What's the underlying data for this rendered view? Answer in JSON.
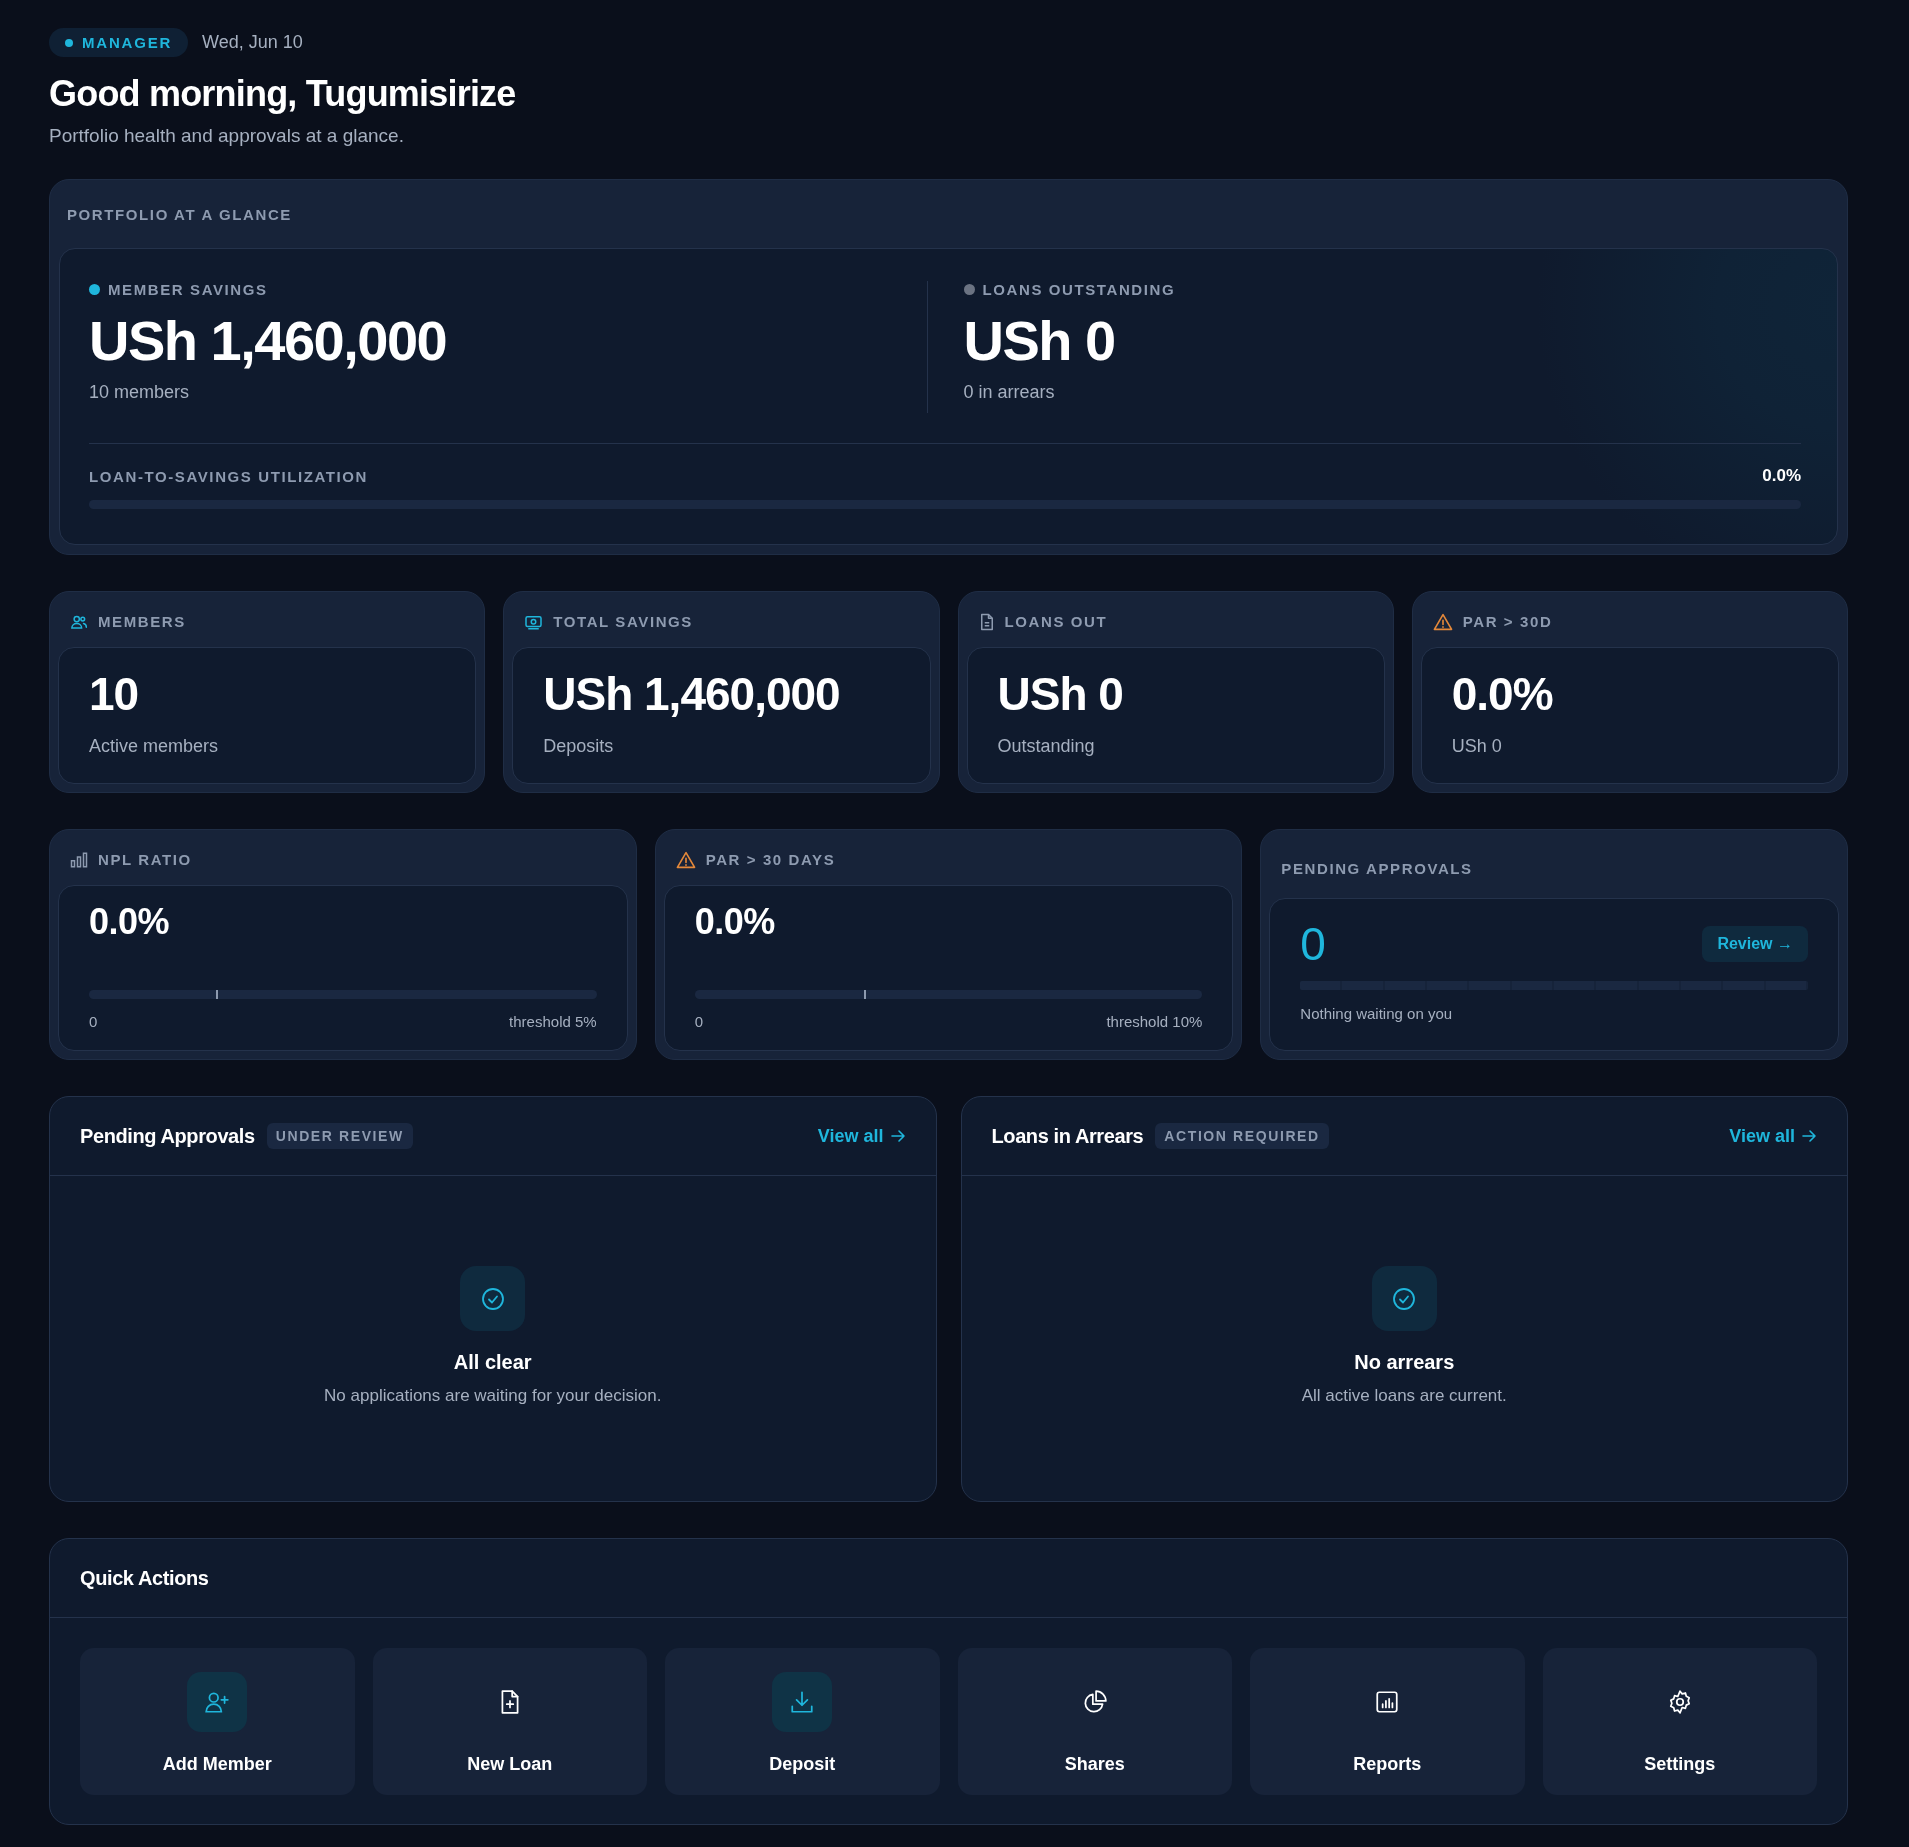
{
  "header": {
    "role": "MANAGER",
    "date": "Wed, Jun 10",
    "title": "Good morning, Tugumisirize",
    "subtitle": "Portfolio health and approvals at a glance."
  },
  "portfolio": {
    "title": "PORTFOLIO AT A GLANCE",
    "metrics": [
      {
        "label": "MEMBER SAVINGS",
        "color": "#1fb6dc",
        "value": "USh 1,460,000",
        "note": "10 members"
      },
      {
        "label": "LOANS OUTSTANDING",
        "color": "#6b7382",
        "value": "USh 0",
        "note": "0 in arrears"
      }
    ],
    "utilization": {
      "label": "LOAN-TO-SAVINGS UTILIZATION",
      "reading": "0.0%",
      "level": 0
    }
  },
  "stat_cards": [
    {
      "kind": "normal",
      "label": "MEMBERS",
      "value": "10",
      "note": "Active members"
    },
    {
      "kind": "normal",
      "label": "TOTAL SAVINGS",
      "value": "USh 1,460,000",
      "note": "Deposits"
    },
    {
      "kind": "muted",
      "label": "LOANS OUT",
      "value": "USh 0",
      "note": "Outstanding"
    },
    {
      "kind": "warning",
      "label": "PAR > 30D",
      "value": "0.0%",
      "note": "USh 0"
    }
  ],
  "ratio_cards": [
    {
      "label": "NPL RATIO",
      "value": "0.0%",
      "level": 0,
      "threshold_marker": {
        "level": 0.25
      },
      "scale_start": "0",
      "threshold": "threshold 5%"
    },
    {
      "label": "PAR > 30 DAYS",
      "value": "0.0%",
      "level": 0,
      "threshold_marker": {
        "level": 0.333
      },
      "scale_start": "0",
      "threshold": "threshold 10%"
    }
  ],
  "pending_card": {
    "label": "PENDING APPROVALS",
    "value": "0",
    "button": "Review →",
    "level": 0,
    "note": "Nothing waiting on you"
  },
  "panels": [
    {
      "title": "Pending Approvals",
      "tag": "UNDER REVIEW",
      "link": "View all",
      "empty_title": "All clear",
      "empty_text": "No applications are waiting for your decision."
    },
    {
      "title": "Loans in Arrears",
      "tag": "ACTION REQUIRED",
      "link": "View all",
      "empty_title": "No arrears",
      "empty_text": "All active loans are current."
    }
  ],
  "quick_actions": {
    "title": "Quick Actions",
    "items": [
      {
        "label": "Add Member",
        "highlighted": true
      },
      {
        "label": "New Loan",
        "highlighted": false
      },
      {
        "label": "Deposit",
        "highlighted": true
      },
      {
        "label": "Shares",
        "highlighted": false
      },
      {
        "label": "Reports",
        "highlighted": false
      },
      {
        "label": "Settings",
        "highlighted": false
      }
    ]
  }
}
